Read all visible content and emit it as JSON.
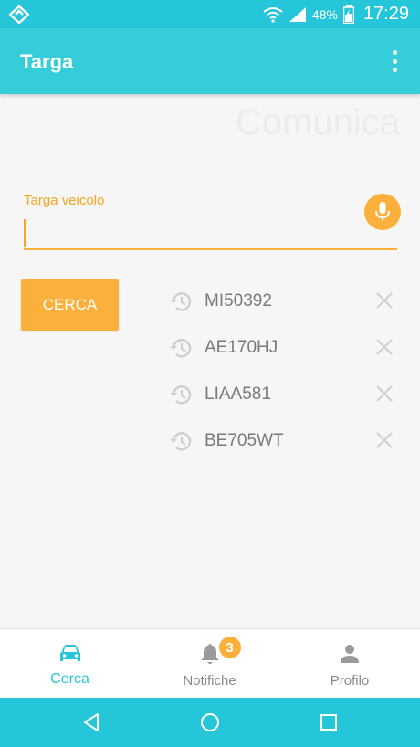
{
  "status_bar": {
    "battery": "48%",
    "time": "17:29"
  },
  "app_bar": {
    "title": "Targa"
  },
  "watermark": "Comunica",
  "plate_field": {
    "label": "Targa veicolo",
    "value": ""
  },
  "search_button": "CERCA",
  "history": [
    {
      "plate": "MI50392"
    },
    {
      "plate": "AE170HJ"
    },
    {
      "plate": "LIAA581"
    },
    {
      "plate": "BE705WT"
    }
  ],
  "bottom_nav": [
    {
      "label": "Cerca",
      "icon": "car-icon",
      "active": true
    },
    {
      "label": "Notifiche",
      "icon": "bell-icon",
      "badge": "3"
    },
    {
      "label": "Profilo",
      "icon": "person-icon"
    }
  ],
  "colors": {
    "primary": "#35cdd9",
    "accent": "#fbb03b",
    "status": "#26c6da"
  }
}
